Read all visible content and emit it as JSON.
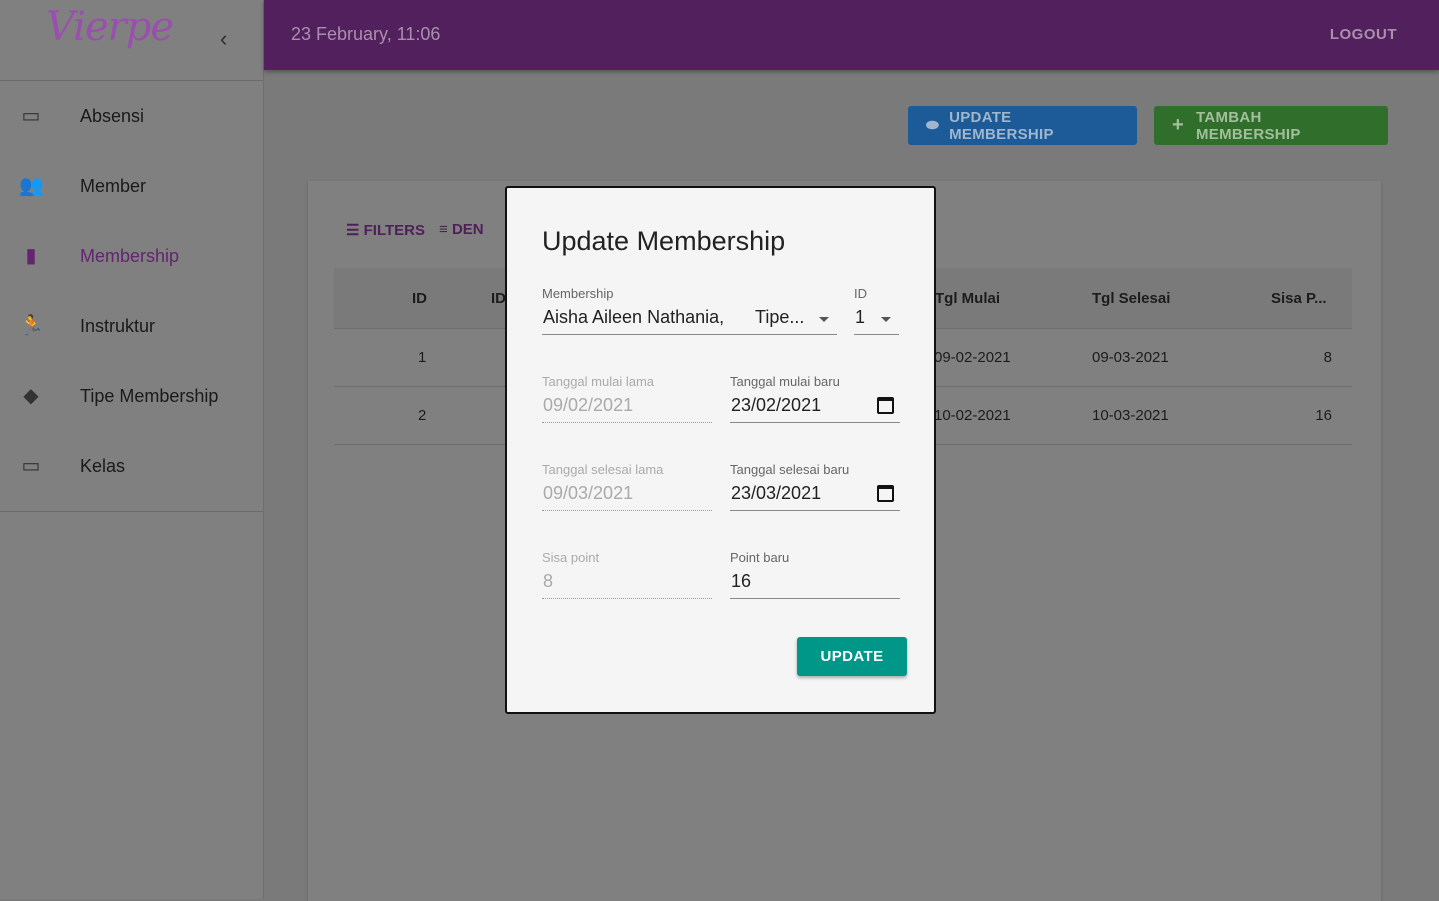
{
  "app": {
    "logo": "Vierpe",
    "date": "23 February,  11:06",
    "logout": "LOGOUT"
  },
  "sidebar": {
    "items": [
      {
        "label": "Absensi",
        "icon": "card-membership-icon"
      },
      {
        "label": "Member",
        "icon": "people-icon"
      },
      {
        "label": "Membership",
        "icon": "book-icon",
        "active": true
      },
      {
        "label": "Instruktur",
        "icon": "running-icon"
      },
      {
        "label": "Tipe Membership",
        "icon": "cards-icon"
      },
      {
        "label": "Kelas",
        "icon": "card-membership-icon"
      }
    ]
  },
  "actions": {
    "update": "UPDATE MEMBERSHIP",
    "add": "TAMBAH MEMBERSHIP"
  },
  "toolbar": {
    "filters": "FILTERS",
    "density": "DEN"
  },
  "table": {
    "headers": [
      "ID",
      "ID",
      "Tgl Mulai",
      "Tgl Selesai",
      "Sisa P..."
    ],
    "rows": [
      [
        "1",
        "09-02-2021",
        "09-03-2021",
        "8"
      ],
      [
        "2",
        "10-02-2021",
        "10-03-2021",
        "16"
      ]
    ]
  },
  "modal": {
    "title": "Update Membership",
    "membership_label": "Membership",
    "membership_value": "Aisha Aileen Nathania,",
    "membership_type": "Tipe...",
    "id_label": "ID",
    "id_value": "1",
    "start_old_label": "Tanggal mulai lama",
    "start_old": "09/02/2021",
    "start_new_label": "Tanggal mulai baru",
    "start_new": "23/02/2021",
    "end_old_label": "Tanggal selesai lama",
    "end_old": "09/03/2021",
    "end_new_label": "Tanggal selesai baru",
    "end_new": "23/03/2021",
    "point_old_label": "Sisa point",
    "point_old": "8",
    "point_new_label": "Point baru",
    "point_new": "16",
    "submit": "UPDATE"
  }
}
